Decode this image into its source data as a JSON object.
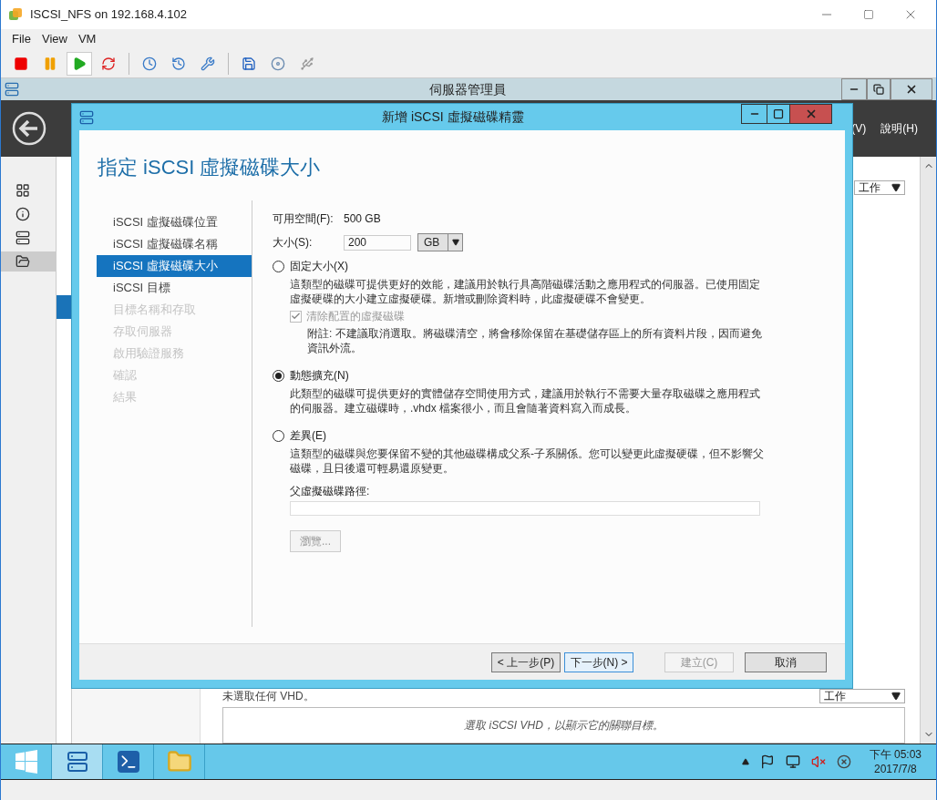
{
  "vm_window": {
    "title": "ISCSI_NFS on 192.168.4.102",
    "menu": [
      {
        "label": "File"
      },
      {
        "label": "View"
      },
      {
        "label": "VM"
      }
    ],
    "toolbar": [
      {
        "kind": "stop",
        "selected": false
      },
      {
        "kind": "pause",
        "selected": false
      },
      {
        "kind": "play",
        "selected": true
      },
      {
        "kind": "reset",
        "selected": false
      },
      {
        "kind": "snapshot",
        "selected": false
      },
      {
        "kind": "revert",
        "selected": false
      },
      {
        "kind": "manage",
        "selected": false
      },
      {
        "kind": "settings",
        "selected": false
      },
      {
        "kind": "cd",
        "selected": false
      },
      {
        "kind": "usb",
        "selected": false
      }
    ]
  },
  "server_manager": {
    "title": "伺服器管理員",
    "header_menu": [
      "(V)",
      "說明(H)"
    ],
    "nav": [
      {
        "kind": "dashboard",
        "selected": false
      },
      {
        "kind": "local",
        "selected": false
      },
      {
        "kind": "all",
        "selected": false
      },
      {
        "kind": "files",
        "selected": true
      }
    ],
    "tasks_top": "工作",
    "status": "未選取任何 VHD。",
    "tasks_bottom": "工作",
    "empty_message": "選取 iSCSI VHD，以顯示它的關聯目標。"
  },
  "dialog": {
    "title": "新增 iSCSI 虛擬磁碟精靈",
    "heading": "指定 iSCSI 虛擬磁碟大小",
    "steps": [
      {
        "label": "iSCSI 虛擬磁碟位置",
        "selected": false,
        "disabled": false
      },
      {
        "label": "iSCSI 虛擬磁碟名稱",
        "selected": false,
        "disabled": false
      },
      {
        "label": "iSCSI 虛擬磁碟大小",
        "selected": true,
        "disabled": false
      },
      {
        "label": "iSCSI 目標",
        "selected": false,
        "disabled": false
      },
      {
        "label": "目標名稱和存取",
        "selected": false,
        "disabled": true
      },
      {
        "label": "存取伺服器",
        "selected": false,
        "disabled": true
      },
      {
        "label": "啟用驗證服務",
        "selected": false,
        "disabled": true
      },
      {
        "label": "確認",
        "selected": false,
        "disabled": true
      },
      {
        "label": "結果",
        "selected": false,
        "disabled": true
      }
    ],
    "free_space": {
      "label": "可用空間(F):",
      "value": "500 GB"
    },
    "size": {
      "label": "大小(S):",
      "value": "200",
      "unit": "GB"
    },
    "options": [
      {
        "label": "固定大小(X)",
        "selected": false,
        "description": "這類型的磁碟可提供更好的效能，建議用於執行具高階磁碟活動之應用程式的伺服器。已使用固定虛擬硬碟的大小建立虛擬硬碟。新增或刪除資料時，此虛擬硬碟不會變更。",
        "checkbox": {
          "label": "清除配置的虛擬磁碟",
          "checked": true,
          "disabled": true,
          "note": "附註: 不建議取消選取。將磁碟清空，將會移除保留在基礎儲存區上的所有資料片段，因而避免資訊外流。"
        }
      },
      {
        "label": "動態擴充(N)",
        "selected": true,
        "description": "此類型的磁碟可提供更好的實體儲存空間使用方式，建議用於執行不需要大量存取磁碟之應用程式的伺服器。建立磁碟時，.vhdx 檔案很小，而且會隨著資料寫入而成長。"
      },
      {
        "label": "差異(E)",
        "selected": false,
        "description": "這類型的磁碟與您要保留不變的其他磁碟構成父系-子系關係。您可以變更此虛擬硬碟，但不影響父磁碟，且日後還可輕易還原變更。",
        "path_label": "父虛擬磁碟路徑:",
        "browse": {
          "label": "瀏覽...",
          "disabled": true
        }
      }
    ],
    "buttons": [
      {
        "label": "< 上一步(P)",
        "disabled": false,
        "default": false
      },
      {
        "label": "下一步(N) >",
        "disabled": false,
        "default": true
      },
      {
        "label": "建立(C)",
        "disabled": true,
        "default": false
      },
      {
        "label": "取消",
        "disabled": false,
        "default": false
      }
    ]
  },
  "taskbar": {
    "items": [
      {
        "kind": "start",
        "selected": false
      },
      {
        "kind": "server",
        "selected": true
      },
      {
        "kind": "powershell",
        "selected": false
      },
      {
        "kind": "explorer",
        "selected": false
      }
    ],
    "time": "下午 05:03",
    "date": "2017/7/8"
  }
}
